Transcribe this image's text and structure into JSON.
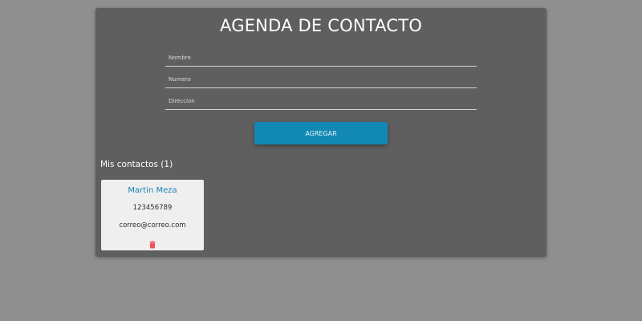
{
  "header": {
    "title": "AGENDA DE CONTACTO"
  },
  "form": {
    "nombre_placeholder": "Nombre",
    "nombre_value": "",
    "numero_placeholder": "Numero",
    "numero_value": "",
    "direccion_placeholder": "Direccion",
    "direccion_value": "",
    "submit_label": "AGREGAR"
  },
  "contacts": {
    "heading": "Mis contactos (1)",
    "items": [
      {
        "name": "Martin Meza",
        "phone": "123456789",
        "email": "correo@correo.com",
        "delete_icon": "trash-icon"
      }
    ]
  },
  "colors": {
    "page_background": "#8f8f8f",
    "panel_background": "#5f5f5f",
    "accent": "#1288b5",
    "contact_name": "#1a7fb0",
    "delete_icon": "#f0505a",
    "card_background": "#efefef"
  }
}
